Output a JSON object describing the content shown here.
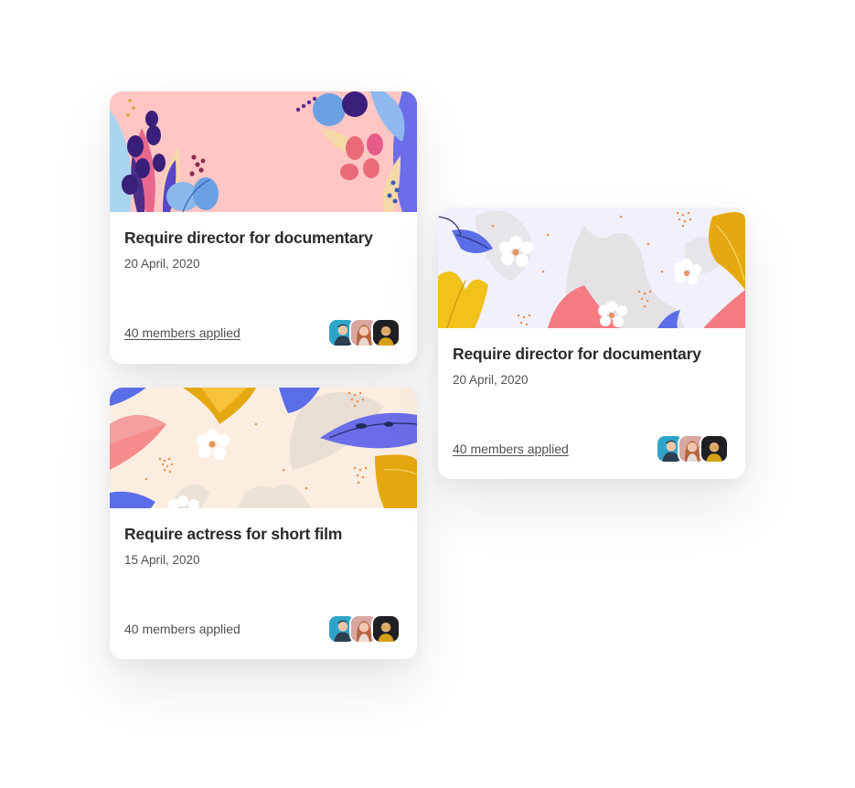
{
  "cards": [
    {
      "title": "Require director for documentary",
      "date": "20 April, 2020",
      "applied": "40 members applied",
      "applied_underlined": true,
      "banner": "pink-leaves"
    },
    {
      "title": "Require actress for short film",
      "date": "15 April, 2020",
      "applied": "40 members applied",
      "applied_underlined": false,
      "banner": "cream-floral"
    },
    {
      "title": "Require director for documentary",
      "date": "20 April, 2020",
      "applied": "40 members applied",
      "applied_underlined": true,
      "banner": "lavender-floral"
    }
  ],
  "colors": {
    "title": "#2a2a2e",
    "meta": "#505056",
    "pink_banner": "#ffc6c4",
    "cream_banner": "#fbeee0",
    "lavender_banner": "#f1f1fb"
  }
}
